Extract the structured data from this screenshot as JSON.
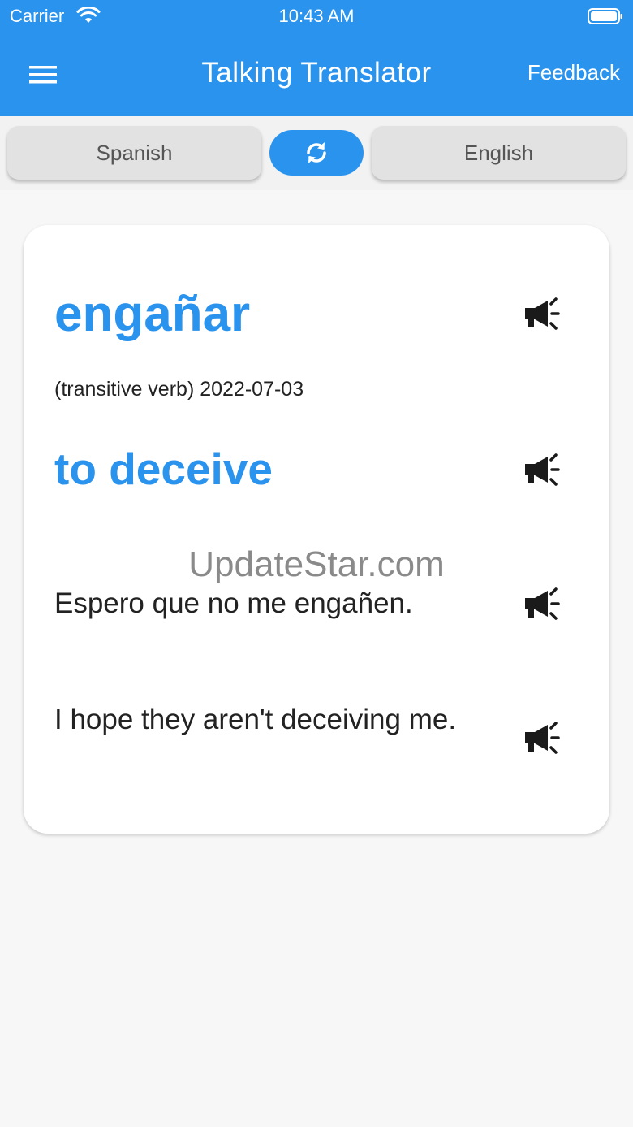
{
  "status_bar": {
    "carrier": "Carrier",
    "time": "10:43 AM"
  },
  "app_bar": {
    "title": "Talking Translator",
    "feedback_label": "Feedback",
    "color": "#2a93ee"
  },
  "languages": {
    "source": "Spanish",
    "target": "English",
    "swap_icon": "refresh-icon"
  },
  "entry": {
    "word": "engañar",
    "meta": "(transitive verb) 2022-07-03",
    "translation": "to deceive",
    "example_source": "Espero que no me engañen.",
    "example_target": "I hope they aren't deceiving me.",
    "speak_icon": "megaphone-icon"
  },
  "watermark": "UpdateStar.com"
}
